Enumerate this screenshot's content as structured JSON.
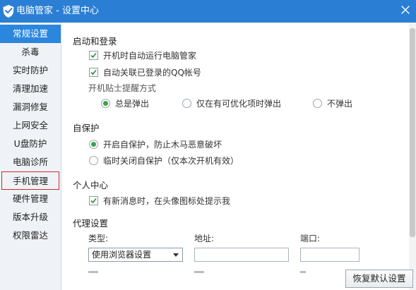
{
  "window": {
    "title": "电脑管家 - 设置中心",
    "colors": {
      "titlebar": "#2a7fd5",
      "sidebar_active": "#2b86dd",
      "highlight_border": "#d02a2a",
      "radio_selected": "#3aa24c"
    }
  },
  "sidebar": {
    "items": [
      {
        "label": "常规设置",
        "active": true
      },
      {
        "label": "杀毒"
      },
      {
        "label": "实时防护"
      },
      {
        "label": "清理加速"
      },
      {
        "label": "漏洞修复"
      },
      {
        "label": "上网安全"
      },
      {
        "label": "U盘防护"
      },
      {
        "label": "电脑诊所"
      },
      {
        "label": "手机管理",
        "highlighted": true
      },
      {
        "label": "硬件管理"
      },
      {
        "label": "版本升级"
      },
      {
        "label": "权限雷达"
      }
    ]
  },
  "startup": {
    "title": "启动和登录",
    "autostart_label": "开机时自动运行电脑管家",
    "autostart_checked": true,
    "qq_link_label": "自动关联已登录的QQ帐号",
    "qq_link_checked": true,
    "tips_title": "开机贴士提醒方式",
    "tips_options": [
      "总是弹出",
      "仅在有可优化项时弹出",
      "不弹出"
    ],
    "tips_selected": "总是弹出"
  },
  "self_protect": {
    "title": "自保护",
    "on_label": "开启自保护，防止木马恶意破坏",
    "off_label": "临时关闭自保护（仅本次开机有效）",
    "selected": "on"
  },
  "personal": {
    "title": "个人中心",
    "notify_label": "有新消息时，在头像图标处提示我",
    "notify_checked": true
  },
  "proxy": {
    "title": "代理设置",
    "type_label": "类型:",
    "type_value": "使用浏览器设置",
    "address_label": "地址:",
    "address_value": "",
    "port_label": "端口:",
    "port_value": ""
  },
  "footer": {
    "restore_label": "恢复默认设置"
  }
}
